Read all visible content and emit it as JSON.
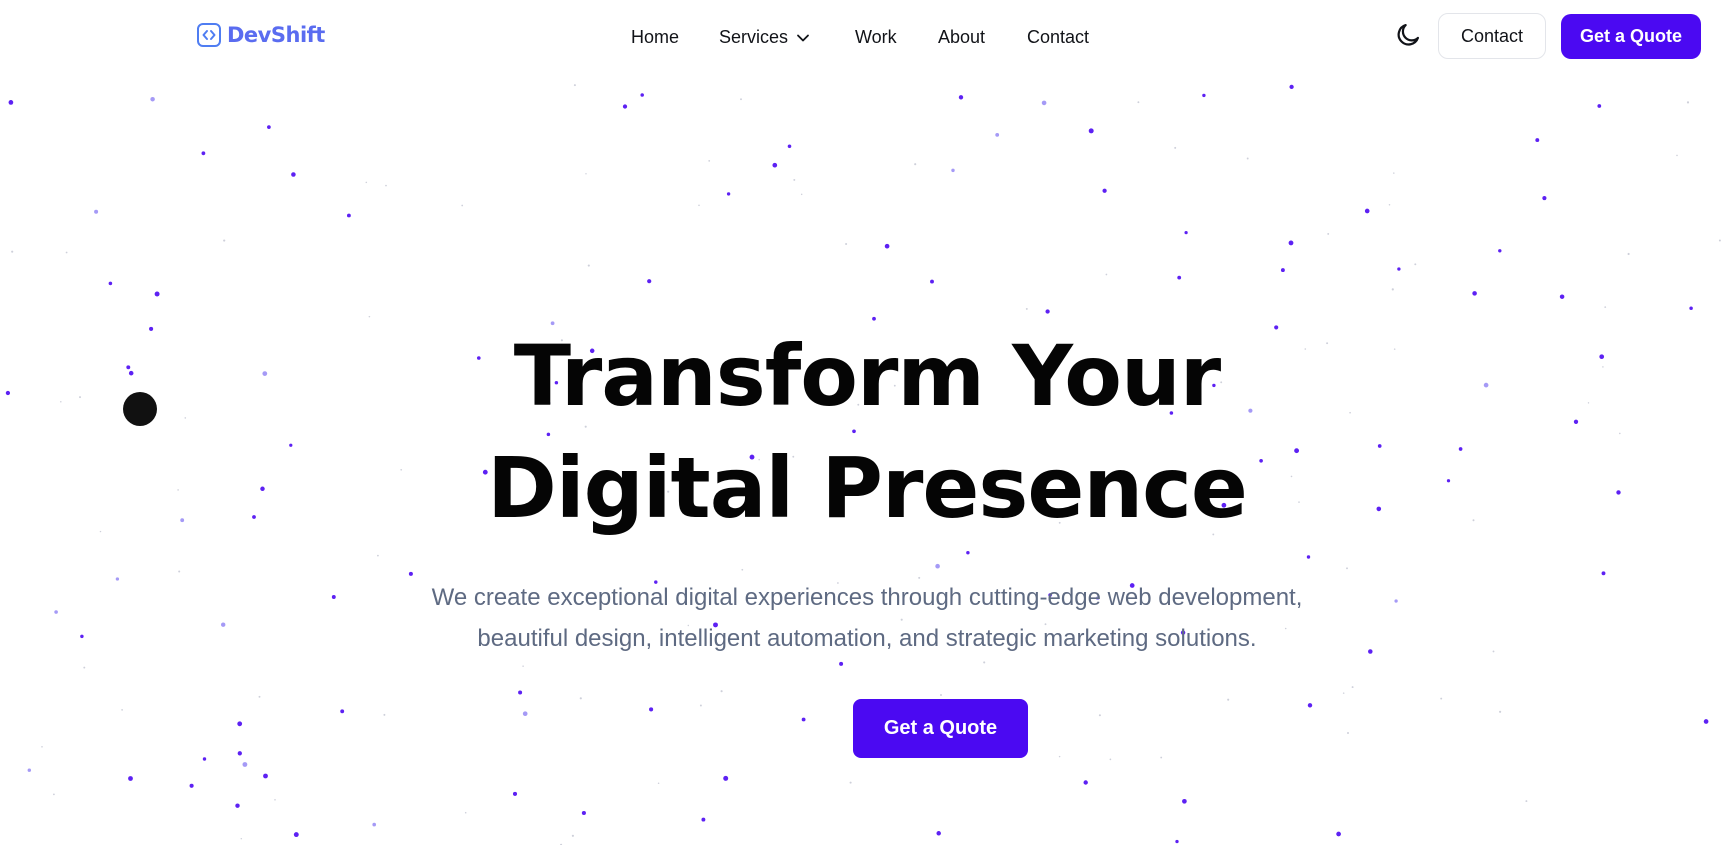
{
  "brand": {
    "name": "DevShift",
    "accent_color": "#4b09f2",
    "logo_color": "#5a6cf0",
    "logo_icon": "code-brackets-icon"
  },
  "nav": {
    "items": [
      {
        "label": "Home"
      },
      {
        "label": "Services",
        "icon": "chevron-down-icon"
      },
      {
        "label": "Work"
      },
      {
        "label": "About"
      },
      {
        "label": "Contact"
      }
    ]
  },
  "header_actions": {
    "theme_toggle_icon": "moon-icon",
    "contact_label": "Contact",
    "quote_label": "Get a Quote"
  },
  "hero": {
    "title": "Transform Your Digital Presence",
    "subtitle": "We create exceptional digital experiences through cutting-edge web development, beautiful design, intelligent automation, and strategic marketing solutions.",
    "cta_label": "Get a Quote"
  },
  "background": {
    "particle_color": "#4b09f2",
    "secondary_particle_color": "#9b8ff5"
  }
}
